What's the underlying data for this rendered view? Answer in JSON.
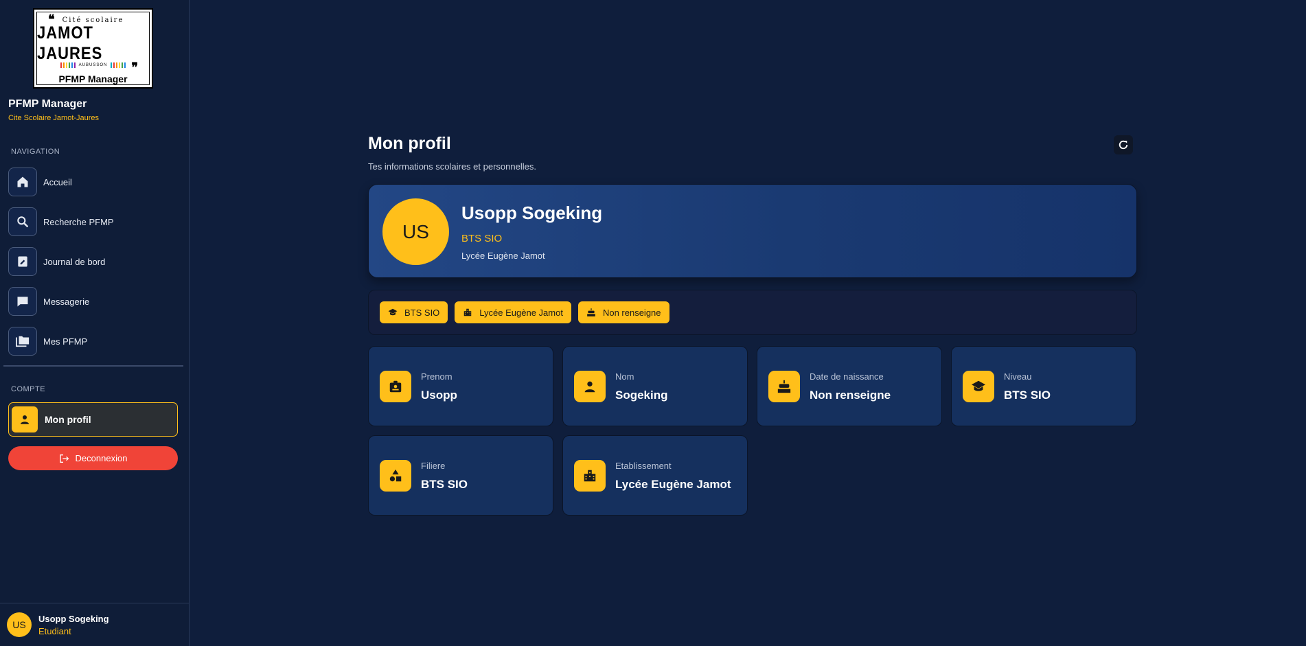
{
  "sidebar": {
    "logo": {
      "line1": "Cité scolaire",
      "line2": "JAMOT JAURES",
      "town": "AUBUSSON",
      "footer": "PFMP Manager",
      "stripe_colors": [
        "#e53935",
        "#fb8c00",
        "#fdd835",
        "#43a047",
        "#1e88e5",
        "#8e24aa",
        "#00acc1",
        "#e53935",
        "#fb8c00",
        "#fdd835",
        "#43a047",
        "#1e88e5"
      ]
    },
    "app_name": "PFMP Manager",
    "app_subtitle": "Cite Scolaire Jamot-Jaures",
    "nav_section": "NAVIGATION",
    "nav_items": [
      {
        "label": "Accueil",
        "icon": "home-icon"
      },
      {
        "label": "Recherche PFMP",
        "icon": "search-icon"
      },
      {
        "label": "Journal de bord",
        "icon": "edit-note-icon"
      },
      {
        "label": "Messagerie",
        "icon": "chat-icon"
      },
      {
        "label": "Mes PFMP",
        "icon": "folder-icon"
      }
    ],
    "account_section": "COMPTE",
    "active_item": {
      "label": "Mon profil",
      "icon": "person-icon"
    },
    "logout_label": "Deconnexion",
    "user": {
      "initials": "US",
      "name": "Usopp Sogeking",
      "role": "Etudiant"
    }
  },
  "main": {
    "title": "Mon profil",
    "subtitle": "Tes informations scolaires et personnelles.",
    "hero": {
      "initials": "US",
      "name": "Usopp Sogeking",
      "grade": "BTS SIO",
      "school": "Lycée Eugène Jamot"
    },
    "chips": [
      {
        "label": "BTS SIO",
        "icon": "graduation-cap-icon"
      },
      {
        "label": "Lycée Eugène Jamot",
        "icon": "building-icon"
      },
      {
        "label": "Non renseigne",
        "icon": "cake-icon"
      }
    ],
    "cards": [
      {
        "label": "Prenom",
        "value": "Usopp",
        "icon": "id-badge-icon"
      },
      {
        "label": "Nom",
        "value": "Sogeking",
        "icon": "person-icon"
      },
      {
        "label": "Date de naissance",
        "value": "Non renseigne",
        "icon": "cake-icon"
      },
      {
        "label": "Niveau",
        "value": "BTS SIO",
        "icon": "graduation-cap-icon"
      },
      {
        "label": "Filiere",
        "value": "BTS SIO",
        "icon": "shapes-icon"
      },
      {
        "label": "Etablissement",
        "value": "Lycée Eugène Jamot",
        "icon": "building-icon"
      }
    ]
  },
  "colors": {
    "accent": "#ffbf1a",
    "danger": "#f04438",
    "background": "#0f1e3c",
    "card": "#15305e"
  }
}
